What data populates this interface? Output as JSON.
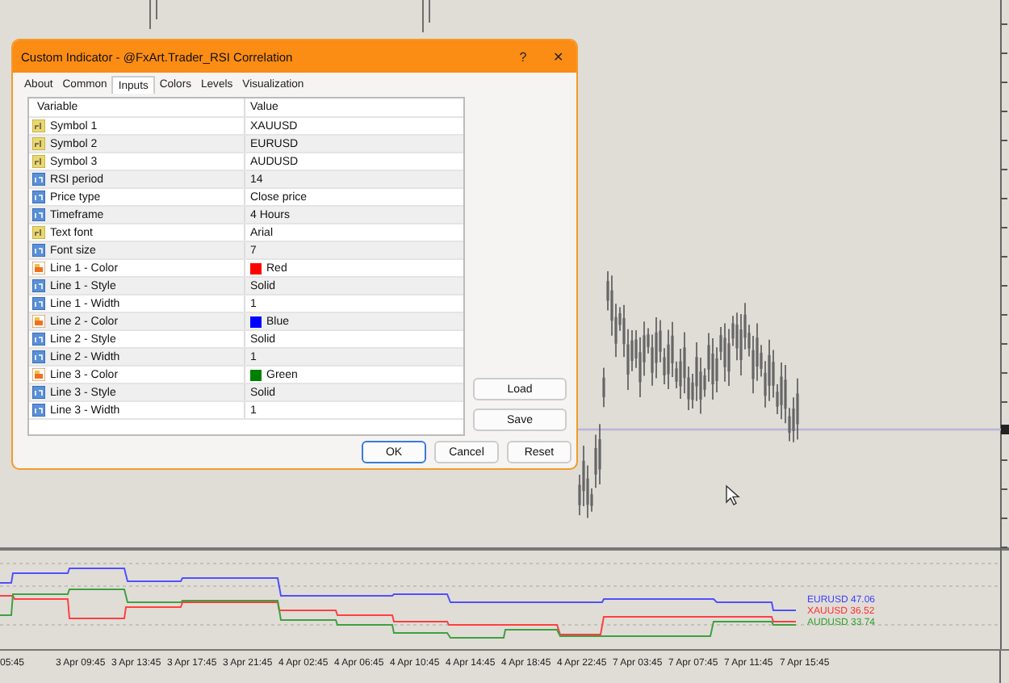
{
  "dialog": {
    "title": "Custom Indicator - @FxArt.Trader_RSI Correlation",
    "help": "?",
    "close": "✕",
    "tabs": [
      {
        "label": "About",
        "selected": false
      },
      {
        "label": "Common",
        "selected": false
      },
      {
        "label": "Inputs",
        "selected": true
      },
      {
        "label": "Colors",
        "selected": false
      },
      {
        "label": "Levels",
        "selected": false
      },
      {
        "label": "Visualization",
        "selected": false
      }
    ],
    "table": {
      "columns": [
        "Variable",
        "Value"
      ],
      "rows": [
        {
          "kind": "string",
          "name": "Symbol 1",
          "value": "XAUUSD"
        },
        {
          "kind": "string",
          "name": "Symbol 2",
          "value": "EURUSD"
        },
        {
          "kind": "string",
          "name": "Symbol 3",
          "value": "AUDUSD"
        },
        {
          "kind": "number",
          "name": "RSI period",
          "value": "14"
        },
        {
          "kind": "number",
          "name": "Price type",
          "value": "Close price"
        },
        {
          "kind": "number",
          "name": "Timeframe",
          "value": "4 Hours"
        },
        {
          "kind": "string",
          "name": "Text font",
          "value": "Arial"
        },
        {
          "kind": "number",
          "name": "Font size",
          "value": "7"
        },
        {
          "kind": "color",
          "name": "Line 1 - Color",
          "value": "Red",
          "color": "#ff0000"
        },
        {
          "kind": "number",
          "name": "Line 1 - Style",
          "value": "Solid"
        },
        {
          "kind": "number",
          "name": "Line 1 - Width",
          "value": "1"
        },
        {
          "kind": "color",
          "name": "Line 2 - Color",
          "value": "Blue",
          "color": "#0000ff"
        },
        {
          "kind": "number",
          "name": "Line 2 - Style",
          "value": "Solid"
        },
        {
          "kind": "number",
          "name": "Line 2 - Width",
          "value": "1"
        },
        {
          "kind": "color",
          "name": "Line 3 - Color",
          "value": "Green",
          "color": "#008000"
        },
        {
          "kind": "number",
          "name": "Line 3 - Style",
          "value": "Solid"
        },
        {
          "kind": "number",
          "name": "Line 3 - Width",
          "value": "1"
        }
      ]
    },
    "side_buttons": [
      "Load",
      "Save"
    ],
    "buttons": [
      {
        "label": "OK",
        "default": true
      },
      {
        "label": "Cancel",
        "default": false
      },
      {
        "label": "Reset",
        "default": false
      }
    ]
  },
  "indicator": {
    "labels": [
      {
        "text": "EURUSD  47.06",
        "color": "#4040ff"
      },
      {
        "text": "XAUUSD  36.52",
        "color": "#ff3030"
      },
      {
        "text": "AUDUSD  33.74",
        "color": "#30a030"
      }
    ]
  },
  "time_axis": [
    "05:45",
    "3 Apr 09:45",
    "3 Apr 13:45",
    "3 Apr 17:45",
    "3 Apr 21:45",
    "4 Apr 02:45",
    "4 Apr 06:45",
    "4 Apr 10:45",
    "4 Apr 14:45",
    "4 Apr 18:45",
    "4 Apr 22:45",
    "7 Apr 03:45",
    "7 Apr 07:45",
    "7 Apr 11:45",
    "7 Apr 15:45"
  ]
}
